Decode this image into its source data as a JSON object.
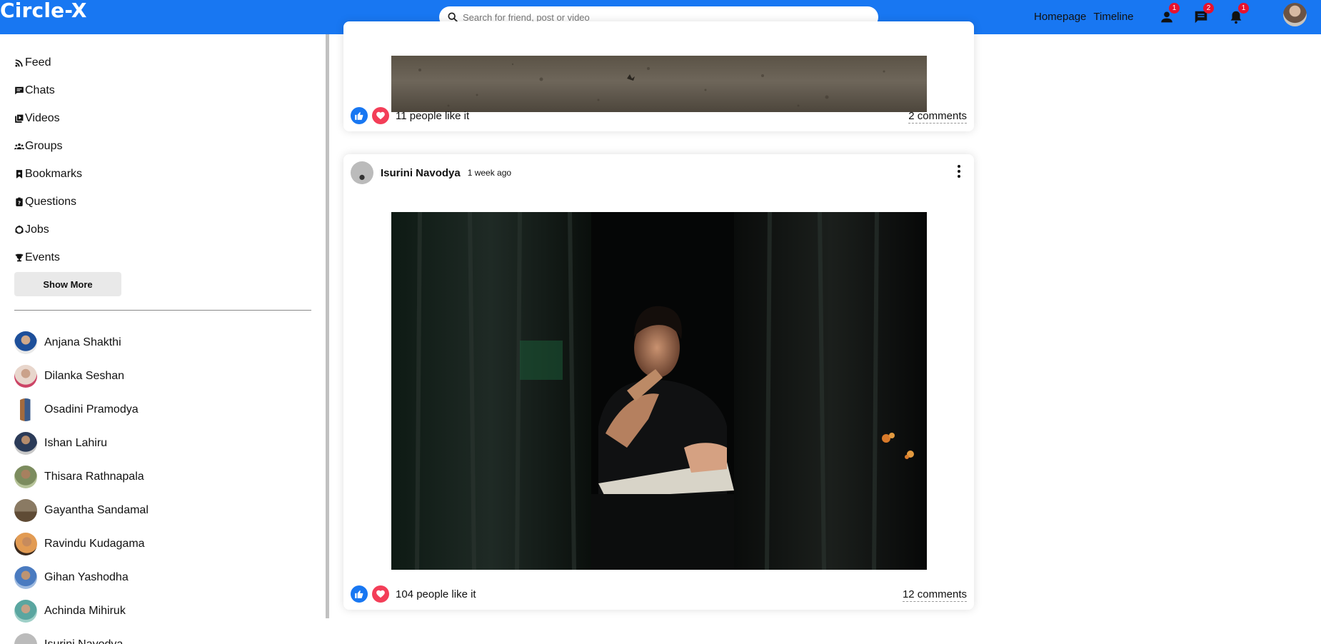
{
  "app": {
    "title": "Circle-X"
  },
  "search": {
    "placeholder": "Search for friend, post or video"
  },
  "topnav": {
    "links": [
      "Homepage",
      "Timeline"
    ],
    "friend_requests_badge": "1",
    "messages_badge": "2",
    "notifications_badge": "1"
  },
  "sidebar": {
    "menu": [
      {
        "label": "Feed",
        "icon": "rss-icon"
      },
      {
        "label": "Chats",
        "icon": "chat-icon"
      },
      {
        "label": "Videos",
        "icon": "video-library-icon"
      },
      {
        "label": "Groups",
        "icon": "group-icon"
      },
      {
        "label": "Bookmarks",
        "icon": "bookmark-icon"
      },
      {
        "label": "Questions",
        "icon": "help-icon"
      },
      {
        "label": "Jobs",
        "icon": "work-icon"
      },
      {
        "label": "Events",
        "icon": "trophy-icon"
      }
    ],
    "show_more": "Show More",
    "friends": [
      {
        "name": "Anjana Shakthi"
      },
      {
        "name": "Dilanka Seshan"
      },
      {
        "name": "Osadini Pramodya"
      },
      {
        "name": "Ishan Lahiru"
      },
      {
        "name": "Thisara Rathnapala"
      },
      {
        "name": "Gayantha Sandamal"
      },
      {
        "name": "Ravindu Kudagama"
      },
      {
        "name": "Gihan Yashodha"
      },
      {
        "name": "Achinda Mihiruk"
      },
      {
        "name": "Isurini Navodya"
      }
    ]
  },
  "posts": [
    {
      "likes": "11 people like it",
      "comments": "2 comments"
    },
    {
      "author": "Isurini Navodya",
      "time": "1 week ago",
      "likes": "104 people like it",
      "comments": "12 comments"
    }
  ],
  "colors": {
    "brand": "#1877f2",
    "badge": "#e8112d",
    "like": "#1877f2",
    "love": "#f33e58"
  }
}
